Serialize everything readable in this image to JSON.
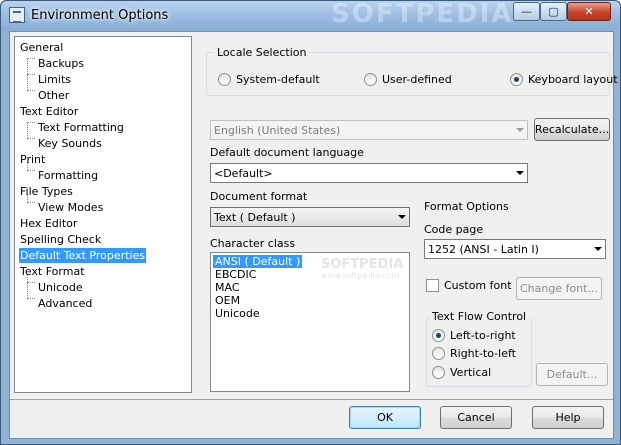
{
  "window": {
    "title": "Environment Options",
    "watermark": "SOFTPEDIA",
    "controls": {
      "minimize": "—",
      "maximize": "▢",
      "close": "✕"
    }
  },
  "tree": {
    "items": [
      {
        "label": "General",
        "level": 0
      },
      {
        "label": "Backups",
        "level": 1
      },
      {
        "label": "Limits",
        "level": 1
      },
      {
        "label": "Other",
        "level": 1
      },
      {
        "label": "Text Editor",
        "level": 0
      },
      {
        "label": "Text Formatting",
        "level": 1
      },
      {
        "label": "Key Sounds",
        "level": 1
      },
      {
        "label": "Print",
        "level": 0
      },
      {
        "label": "Formatting",
        "level": 1
      },
      {
        "label": "File Types",
        "level": 0
      },
      {
        "label": "View Modes",
        "level": 1
      },
      {
        "label": "Hex Editor",
        "level": 0
      },
      {
        "label": "Spelling Check",
        "level": 0
      },
      {
        "label": "Default Text Properties",
        "level": 0,
        "selected": true
      },
      {
        "label": "Text Format",
        "level": 0
      },
      {
        "label": "Unicode",
        "level": 1
      },
      {
        "label": "Advanced",
        "level": 1
      }
    ]
  },
  "locale": {
    "group_title": "Locale Selection",
    "options": [
      {
        "label": "System-default",
        "checked": false
      },
      {
        "label": "User-defined",
        "checked": false
      },
      {
        "label": "Keyboard layout",
        "checked": true
      }
    ],
    "locale_value": "English (United States)",
    "recalculate_label": "Recalculate..."
  },
  "document_language": {
    "label": "Default document language",
    "value": "<Default>"
  },
  "document_format": {
    "label": "Document format",
    "value": "Text ( Default )"
  },
  "character_class": {
    "label": "Character class",
    "items": [
      {
        "label": "ANSI ( Default )",
        "selected": true
      },
      {
        "label": "EBCDIC",
        "selected": false
      },
      {
        "label": "MAC",
        "selected": false
      },
      {
        "label": "OEM",
        "selected": false
      },
      {
        "label": "Unicode",
        "selected": false
      }
    ],
    "watermark": "SOFTPEDIA",
    "watermark_url": "www.softpedia.com"
  },
  "format_options": {
    "title": "Format Options",
    "code_page_label": "Code page",
    "code_page_value": "1252  (ANSI - Latin I)",
    "custom_font_label": "Custom font",
    "custom_font_checked": false,
    "change_font_label": "Change font..."
  },
  "text_flow": {
    "title": "Text Flow Control",
    "options": [
      {
        "label": "Left-to-right",
        "checked": true
      },
      {
        "label": "Right-to-left",
        "checked": false
      },
      {
        "label": "Vertical",
        "checked": false
      }
    ],
    "default_label": "Default..."
  },
  "footer": {
    "ok_label": "OK",
    "cancel_label": "Cancel",
    "help_label": "Help"
  },
  "colors": {
    "selection": "#3399ff",
    "titlebar": "#9dbfe3",
    "close_button": "#c6432a",
    "dialog_bg": "#f0f0f0"
  }
}
